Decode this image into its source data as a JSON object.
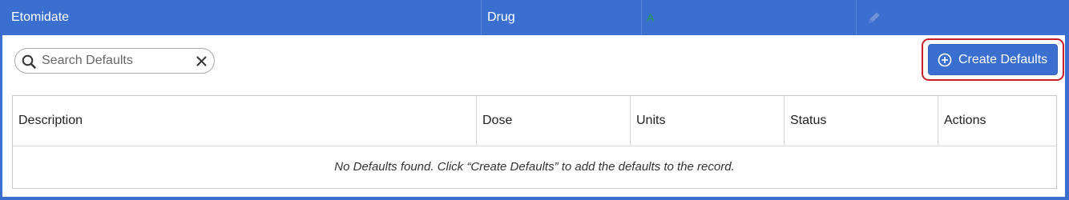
{
  "header_row": {
    "name": "Etomidate",
    "type": "Drug",
    "status": "A",
    "edit_icon": "pencil-icon"
  },
  "search": {
    "placeholder": "Search Defaults",
    "value": "",
    "search_icon": "search-icon",
    "clear_icon": "close-icon"
  },
  "toolbar": {
    "create_label": "Create Defaults",
    "create_icon": "plus-circle-icon"
  },
  "table": {
    "columns": [
      "Description",
      "Dose",
      "Units",
      "Status",
      "Actions"
    ],
    "empty_message": "No Defaults found. Click “Create Defaults” to add the defaults to the record."
  },
  "colors": {
    "header_blue": "#3a6fd0",
    "status_green": "#1e9e4a",
    "highlight_red": "#c8202a"
  }
}
